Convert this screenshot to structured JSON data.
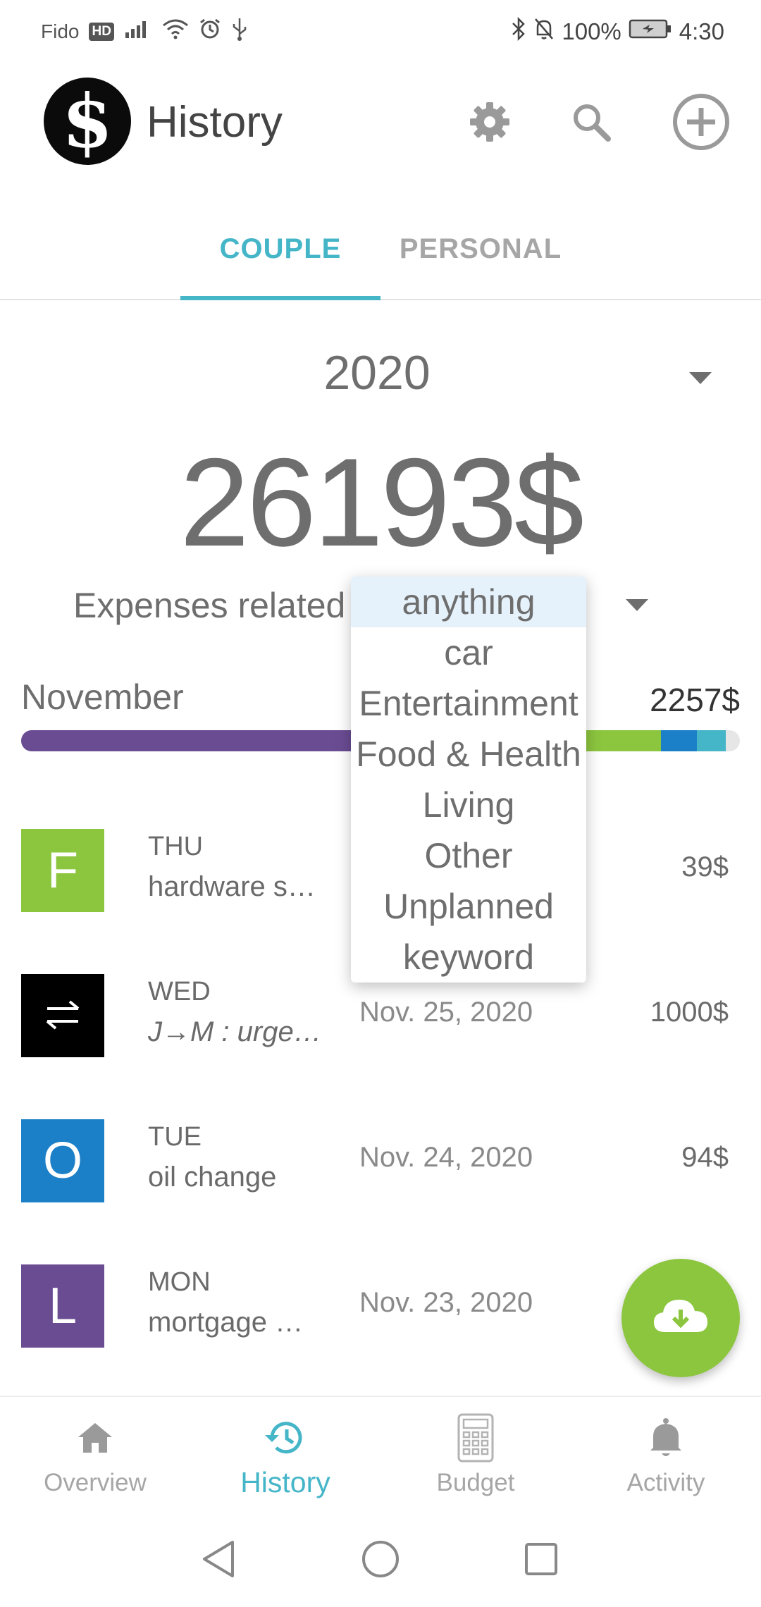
{
  "status_bar": {
    "carrier": "Fido",
    "hd_badge": "HD",
    "battery": "100%",
    "time": "4:30"
  },
  "app_bar": {
    "logo_glyph": "$",
    "title": "History"
  },
  "tabs": [
    {
      "label": "COUPLE",
      "active": true
    },
    {
      "label": "PERSONAL",
      "active": false
    }
  ],
  "summary": {
    "year": "2020",
    "total": "26193$",
    "filter_label": "Expenses related to"
  },
  "month": {
    "name": "November",
    "total": "2257$",
    "breakdown": [
      {
        "category": "Living",
        "color": "#6a4c93",
        "fraction": 0.48
      },
      {
        "category": "Food & Health",
        "color": "#8cc63f",
        "fraction": 0.41
      },
      {
        "category": "car",
        "color": "#1b80c8",
        "fraction": 0.05
      },
      {
        "category": "Entertainment",
        "color": "#45b5c8",
        "fraction": 0.04
      }
    ]
  },
  "transactions": [
    {
      "letter": "F",
      "color": "#8cc63f",
      "day": "THU",
      "description": "hardware s…",
      "italic": false,
      "date": "",
      "amount": "39$"
    },
    {
      "letter": "",
      "color": "#000000",
      "icon": "transfer-arrows-icon",
      "day": "WED",
      "description": "J→M : urge…",
      "italic": true,
      "date": "Nov. 25, 2020",
      "amount": "1000$"
    },
    {
      "letter": "O",
      "color": "#1b80c8",
      "day": "TUE",
      "description": "oil change",
      "italic": false,
      "date": "Nov. 24, 2020",
      "amount": "94$"
    },
    {
      "letter": "L",
      "color": "#6a4c93",
      "day": "MON",
      "description": "mortgage …",
      "italic": false,
      "date": "Nov. 23, 2020",
      "amount": ""
    }
  ],
  "filter_dropdown": {
    "selected": "anything",
    "options": [
      "anything",
      "car",
      "Entertainment",
      "Food & Health",
      "Living",
      "Other",
      "Unplanned",
      "keyword"
    ]
  },
  "fab": {
    "icon": "cloud-download-icon"
  },
  "bottom_nav": [
    {
      "label": "Overview",
      "icon": "home-icon",
      "active": false
    },
    {
      "label": "History",
      "icon": "history-icon",
      "active": true
    },
    {
      "label": "Budget",
      "icon": "calculator-icon",
      "active": false
    },
    {
      "label": "Activity",
      "icon": "bell-icon",
      "active": false
    }
  ],
  "colors": {
    "accent": "#45b5c8",
    "fab": "#8cc63f",
    "text": "#6e6e6e"
  }
}
